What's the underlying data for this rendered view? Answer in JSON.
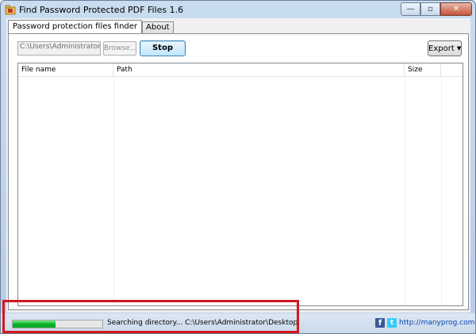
{
  "window": {
    "title": "Find Password Protected PDF Files 1.6",
    "icon": "app-folder-icon",
    "minimize_glyph": "—",
    "maximize_glyph": "▫",
    "close_glyph": "✕"
  },
  "tabs": [
    {
      "label": "Password protection files finder",
      "active": true
    },
    {
      "label": "About",
      "active": false
    }
  ],
  "toolbar": {
    "path_value": "C:\\Users\\Administrator\\Desktop",
    "browse_label": "Browse...",
    "stop_label": "Stop",
    "export_label": "Export",
    "export_caret": "▼"
  },
  "table": {
    "columns": [
      "File name",
      "Path",
      "Size"
    ],
    "rows": []
  },
  "status": {
    "progress_fraction": 0.48,
    "text": "Searching directory... C:\\Users\\Administrator\\Desktop",
    "facebook_glyph": "f",
    "twitter_glyph": "t",
    "link": "http://manyprog.com"
  },
  "colors": {
    "highlight": "#d3171e",
    "progress": "#06b025",
    "link": "#0645ad"
  }
}
